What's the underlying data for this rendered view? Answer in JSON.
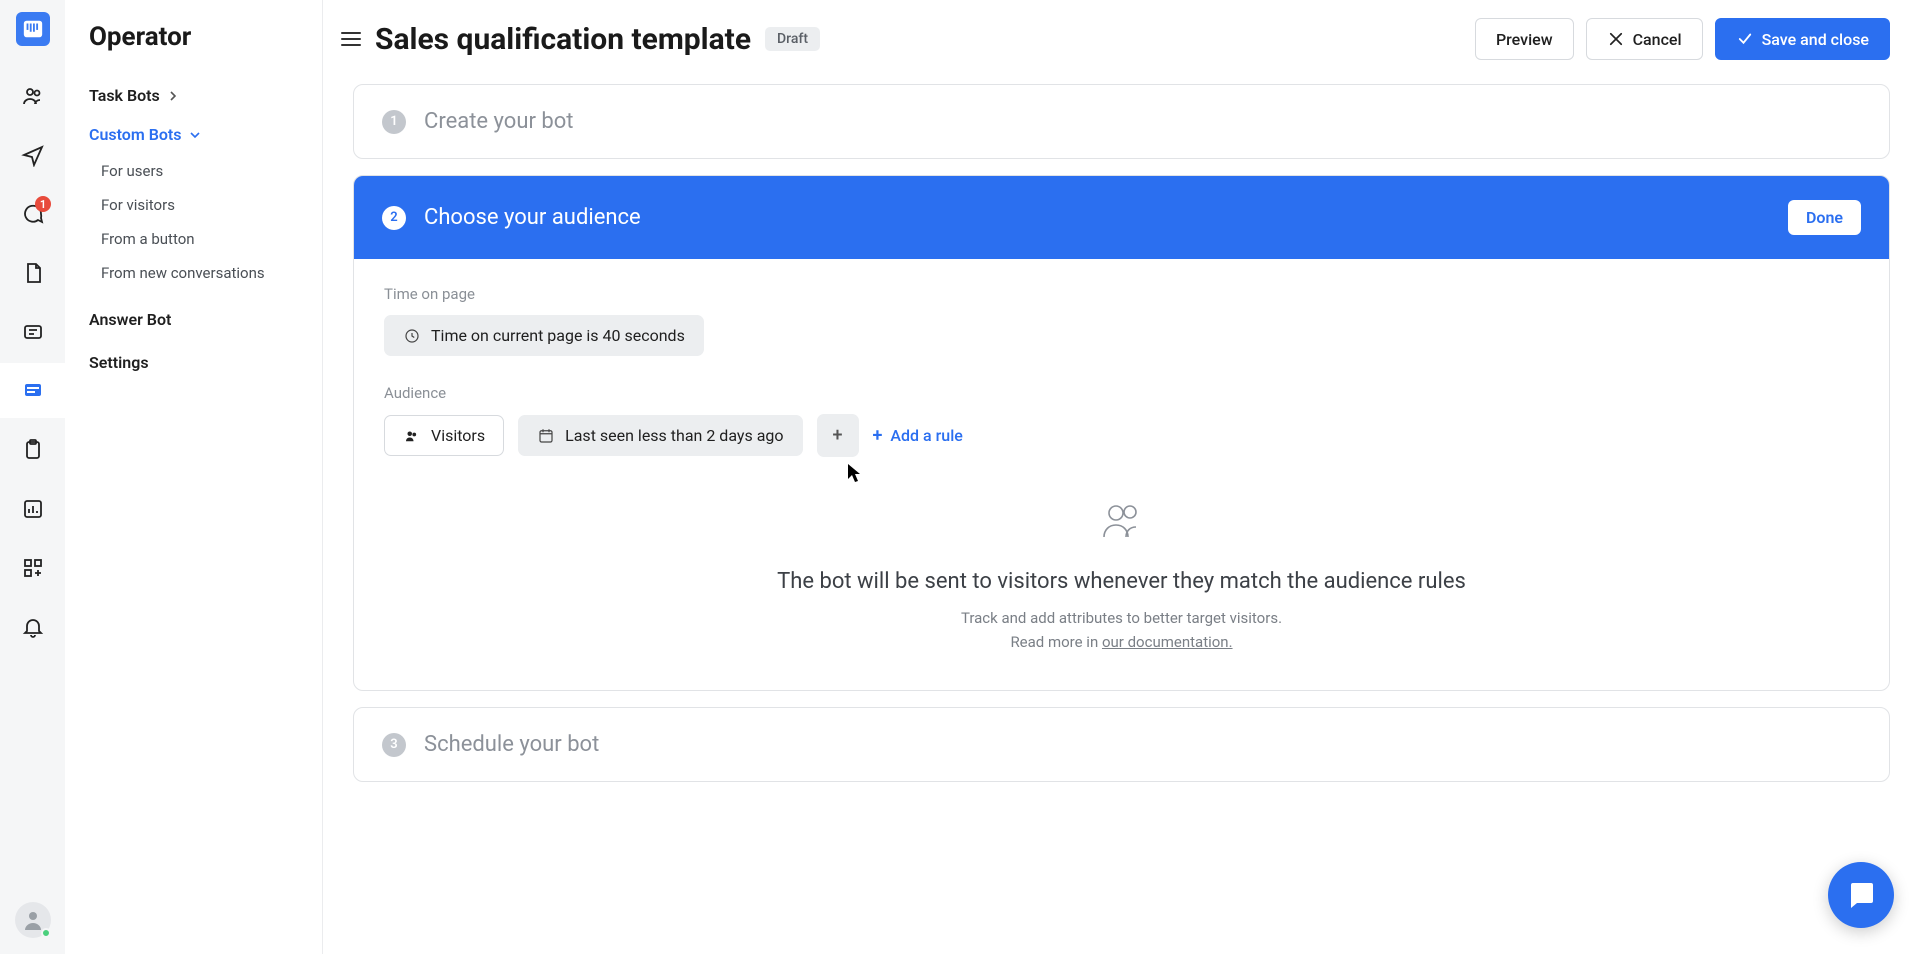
{
  "rail": {
    "badge_count": "1"
  },
  "sidebar": {
    "title": "Operator",
    "sections": {
      "task_bots": "Task Bots",
      "custom_bots": "Custom Bots"
    },
    "subs": {
      "for_users": "For users",
      "for_visitors": "For visitors",
      "from_button": "From a button",
      "from_new_conv": "From new conversations"
    },
    "answer_bot": "Answer Bot",
    "settings": "Settings"
  },
  "header": {
    "title": "Sales qualification template",
    "draft_label": "Draft",
    "preview": "Preview",
    "cancel": "Cancel",
    "save": "Save and close"
  },
  "steps": {
    "s1": {
      "num": "1",
      "title": "Create your bot"
    },
    "s2": {
      "num": "2",
      "title": "Choose your audience",
      "done": "Done"
    },
    "s3": {
      "num": "3",
      "title": "Schedule your bot"
    }
  },
  "audience": {
    "time_label": "Time on page",
    "time_rule": "Time on current page is 40 seconds",
    "audience_label": "Audience",
    "visitors_chip": "Visitors",
    "last_seen_chip": "Last seen less than 2 days ago",
    "add_rule": "Add a rule",
    "empty_title": "The bot will be sent to visitors whenever they match the audience rules",
    "empty_line1": "Track and add attributes to better target visitors.",
    "empty_line2_prefix": "Read more in ",
    "empty_link": "our documentation."
  }
}
